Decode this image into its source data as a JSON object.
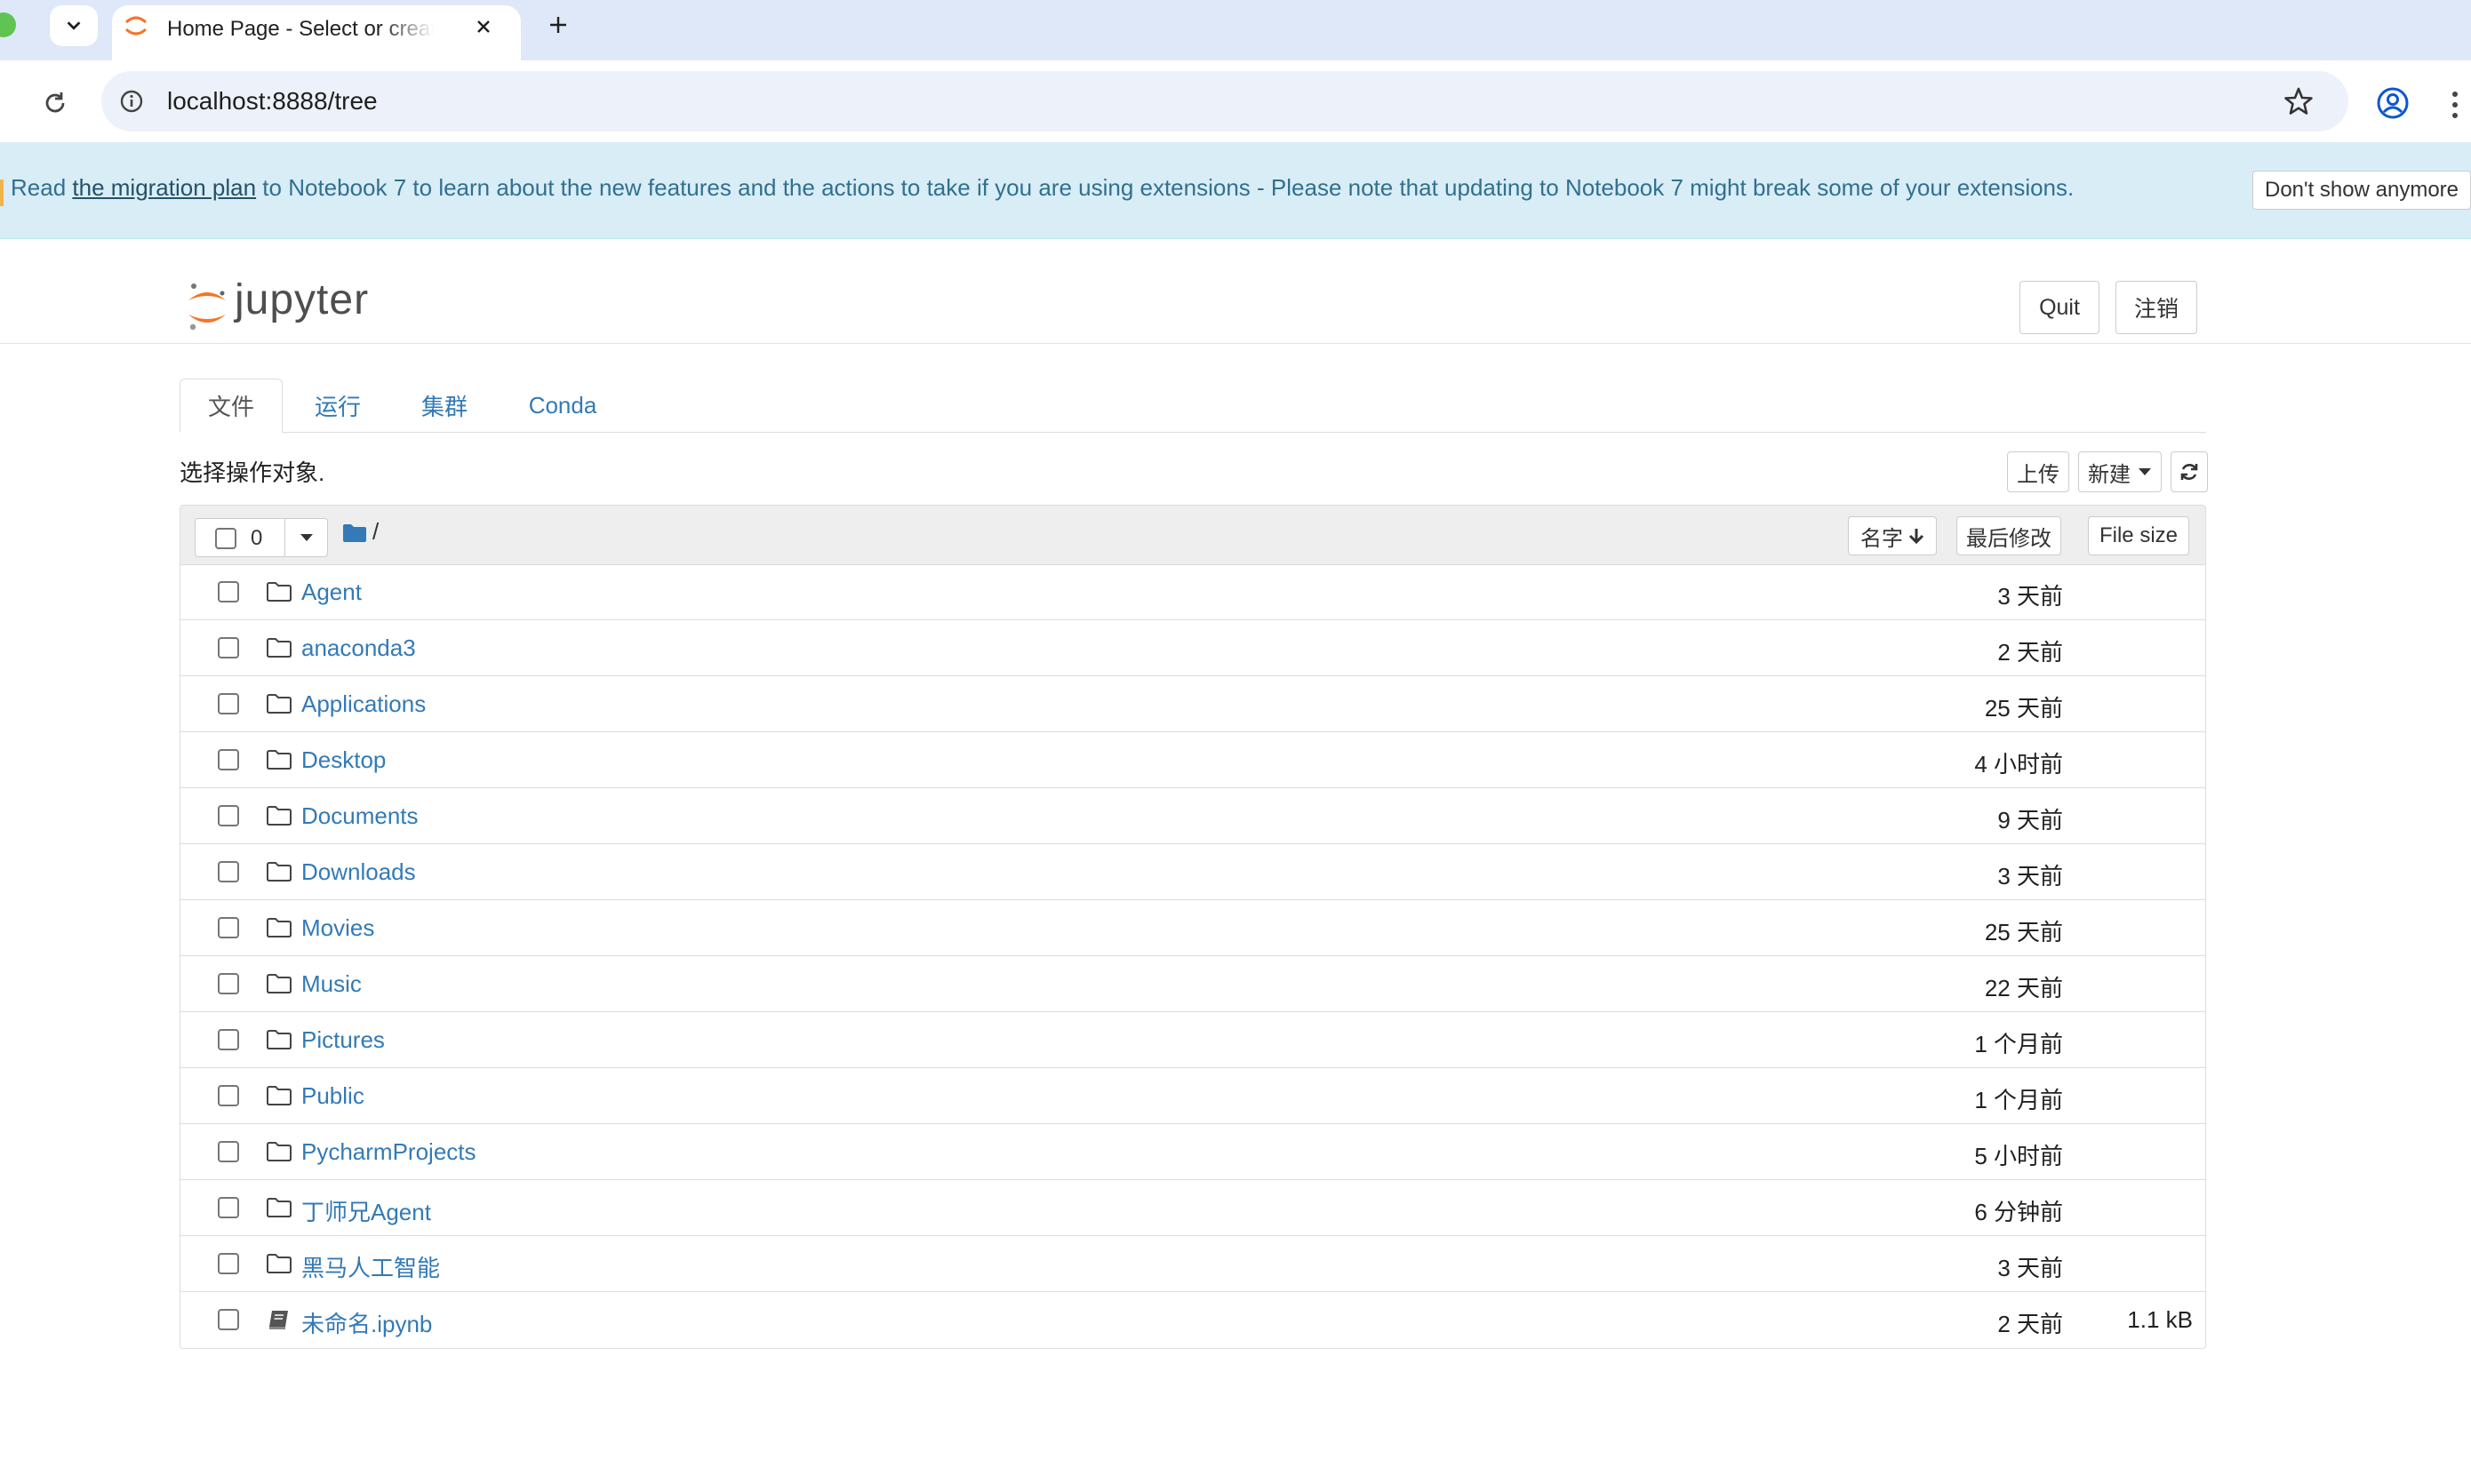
{
  "browser": {
    "tab_title": "Home Page - Select or create a notebook",
    "url": "localhost:8888/tree"
  },
  "banner": {
    "prefix": "Read ",
    "link": "the migration plan",
    "suffix": " to Notebook 7 to learn about the new features and the actions to take if you are using extensions - Please note that updating to Notebook 7 might break some of your extensions.",
    "dismiss": "Don't show anymore"
  },
  "header": {
    "brand": "jupyter",
    "quit": "Quit",
    "logout": "注销"
  },
  "tabs": [
    "文件",
    "运行",
    "集群",
    "Conda"
  ],
  "toolbar": {
    "select_label": "选择操作对象.",
    "upload": "上传",
    "new": "新建"
  },
  "list_header": {
    "selected_count": "0",
    "path": "/",
    "sort_name": "名字",
    "sort_modified": "最后修改",
    "sort_size": "File size"
  },
  "files": [
    {
      "name": "Agent",
      "modified": "3 天前",
      "size": "",
      "type": "folder"
    },
    {
      "name": "anaconda3",
      "modified": "2 天前",
      "size": "",
      "type": "folder"
    },
    {
      "name": "Applications",
      "modified": "25 天前",
      "size": "",
      "type": "folder"
    },
    {
      "name": "Desktop",
      "modified": "4 小时前",
      "size": "",
      "type": "folder"
    },
    {
      "name": "Documents",
      "modified": "9 天前",
      "size": "",
      "type": "folder"
    },
    {
      "name": "Downloads",
      "modified": "3 天前",
      "size": "",
      "type": "folder"
    },
    {
      "name": "Movies",
      "modified": "25 天前",
      "size": "",
      "type": "folder"
    },
    {
      "name": "Music",
      "modified": "22 天前",
      "size": "",
      "type": "folder"
    },
    {
      "name": "Pictures",
      "modified": "1 个月前",
      "size": "",
      "type": "folder"
    },
    {
      "name": "Public",
      "modified": "1 个月前",
      "size": "",
      "type": "folder"
    },
    {
      "name": "PycharmProjects",
      "modified": "5 小时前",
      "size": "",
      "type": "folder"
    },
    {
      "name": "丁师兄Agent",
      "modified": "6 分钟前",
      "size": "",
      "type": "folder"
    },
    {
      "name": "黑马人工智能",
      "modified": "3 天前",
      "size": "",
      "type": "folder"
    },
    {
      "name": "未命名.ipynb",
      "modified": "2 天前",
      "size": "1.1 kB",
      "type": "notebook"
    }
  ],
  "colors": {
    "link": "#337ab7",
    "banner_bg": "#d9edf7",
    "banner_text": "#31708f",
    "jupyter_orange": "#f37626",
    "chrome_tabstrip": "#dfe8f8"
  }
}
